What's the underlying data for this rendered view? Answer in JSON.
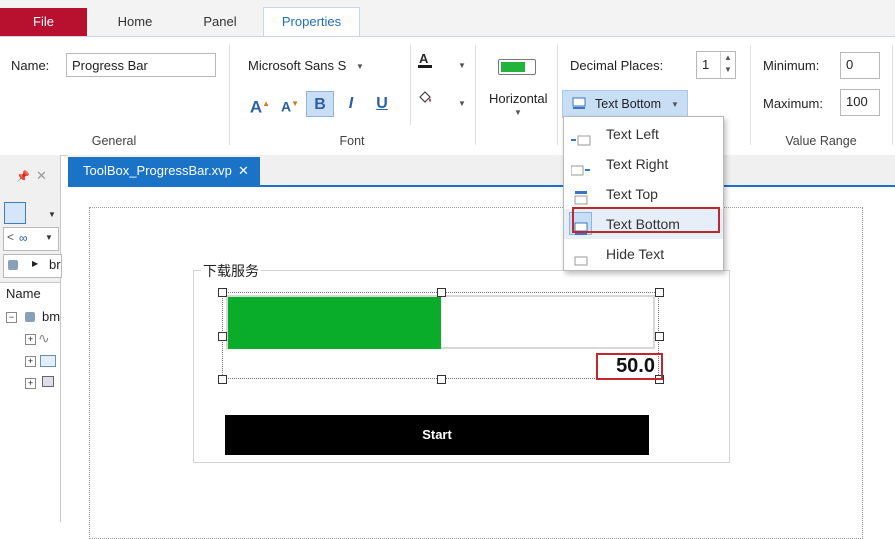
{
  "ribbon_tabs": [
    "File",
    "Home",
    "Panel",
    "Properties"
  ],
  "general": {
    "group_label": "General",
    "name_label": "Name:",
    "name_value": "Progress Bar"
  },
  "font": {
    "group_label": "Font",
    "font_name": "Microsoft Sans Sе",
    "grow_font": "A",
    "shrink_font": "A",
    "bold": "B",
    "italic": "I",
    "underline": "U"
  },
  "orientation": {
    "label": "Horizontal"
  },
  "decimal": {
    "label": "Decimal Places:",
    "value": "1",
    "text_position_button": "Text Bottom"
  },
  "value_range": {
    "group_label": "Value Range",
    "min_label": "Minimum:",
    "min_value": "0",
    "max_label": "Maximum:",
    "max_value": "100"
  },
  "text_position_menu": [
    "Text Left",
    "Text Right",
    "Text Top",
    "Text Bottom",
    "Hide Text"
  ],
  "selected_menu_item": "Text Bottom",
  "left_panel": {
    "partial_text": "br",
    "name_header": "Name",
    "tree_root": "bm"
  },
  "document_tab": {
    "title": "ToolBox_ProgressBar.xvp",
    "close": "✕"
  },
  "canvas": {
    "group_title": "下载服务",
    "progress_value": "50.0",
    "progress_fraction": 0.5,
    "start_button": "Start"
  },
  "colors": {
    "file_tab": "#b8102f",
    "accent": "#1a73c7",
    "progress_fill": "#0aad2a",
    "highlight_border": "#c4262e"
  }
}
